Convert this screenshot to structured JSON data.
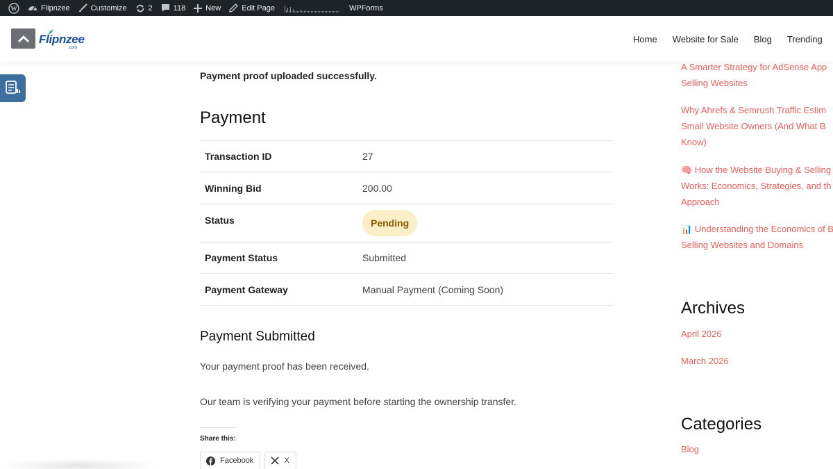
{
  "admin_bar": {
    "site_name": "Flipnzee",
    "customize": "Customize",
    "updates_count": "2",
    "comments_count": "118",
    "new_label": "New",
    "edit_page": "Edit Page",
    "wpforms": "WPForms"
  },
  "header": {
    "logo_text": "Flipnzee",
    "logo_sub": ".com",
    "nav": [
      "Home",
      "Website for Sale",
      "Blog",
      "Trending"
    ]
  },
  "main": {
    "notice": "Payment proof uploaded successfully.",
    "payment_heading": "Payment",
    "rows": [
      {
        "label": "Transaction ID",
        "value": "27"
      },
      {
        "label": "Winning Bid",
        "value": "200.00"
      },
      {
        "label": "Status",
        "value": "Pending"
      },
      {
        "label": "Payment Status",
        "value": "Submitted"
      },
      {
        "label": "Payment Gateway",
        "value": "Manual Payment (Coming Soon)"
      }
    ],
    "submitted_heading": "Payment Submitted",
    "message_1": "Your payment proof has been received.",
    "message_2": "Our team is verifying your payment before starting the ownership transfer.",
    "share_label": "Share this:",
    "share_facebook": "Facebook",
    "share_x": "X"
  },
  "sidebar": {
    "recent_posts": [
      {
        "line1": "A Smarter Strategy for AdSense App",
        "line2": "Selling Websites"
      },
      {
        "line1": "Why Ahrefs & Semrush Traffic Estim",
        "line2": "Small Website Owners (And What B",
        "line3": "Know)"
      },
      {
        "line1": "🧠 How the Website Buying & Selling",
        "line2": "Works: Economics, Strategies, and th",
        "line3": "Approach"
      },
      {
        "line1": "📊 Understanding the Economics of B",
        "line2": "Selling Websites and Domains"
      }
    ],
    "archives_heading": "Archives",
    "archives": [
      "April 2026",
      "March 2026"
    ],
    "categories_heading": "Categories",
    "categories": [
      "Blog"
    ]
  },
  "colors": {
    "admin_bar_bg": "#1d2327",
    "link": "#e8605a",
    "badge_bg": "#fcefc7",
    "badge_text": "#8a5a00",
    "brand": "#1a4fa0"
  }
}
